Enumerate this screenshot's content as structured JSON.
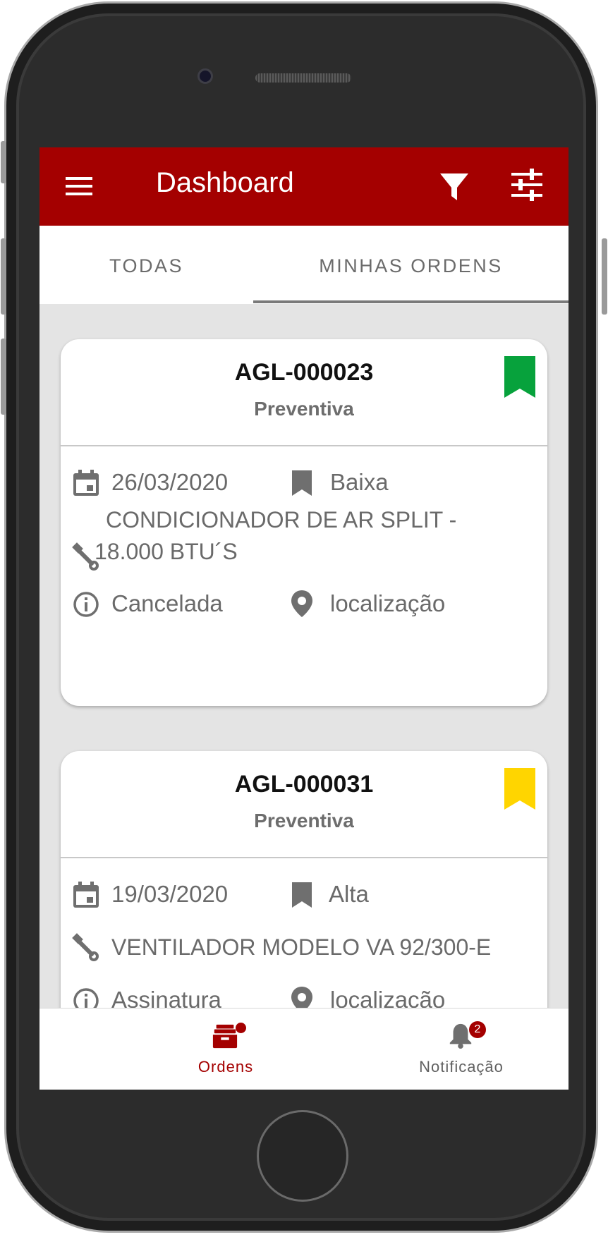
{
  "appbar": {
    "title": "Dashboard",
    "icons": {
      "menu": "menu-icon",
      "filter": "filter-icon",
      "settings": "tune-icon"
    }
  },
  "tabs": [
    {
      "label": "TODAS",
      "active": false
    },
    {
      "label": "MINHAS ORDENS",
      "active": true
    }
  ],
  "orders": [
    {
      "code": "AGL-000023",
      "type": "Preventiva",
      "priority_color": "#07a23c",
      "date": "26/03/2020",
      "priority": "Baixa",
      "equipment": "CONDICIONADOR DE AR SPLIT - 18.000 BTU´S",
      "status": "Cancelada",
      "location": "localização"
    },
    {
      "code": "AGL-000031",
      "type": "Preventiva",
      "priority_color": "#ffd500",
      "date": "19/03/2020",
      "priority": "Alta",
      "equipment": "VENTILADOR MODELO VA 92/300-E",
      "status": "Assinatura",
      "location": "localização"
    }
  ],
  "bottom_nav": {
    "orders_label": "Ordens",
    "notifications_label": "Notificação",
    "notifications_count": "2"
  },
  "colors": {
    "primary": "#a40000",
    "background": "#e4e4e4"
  }
}
